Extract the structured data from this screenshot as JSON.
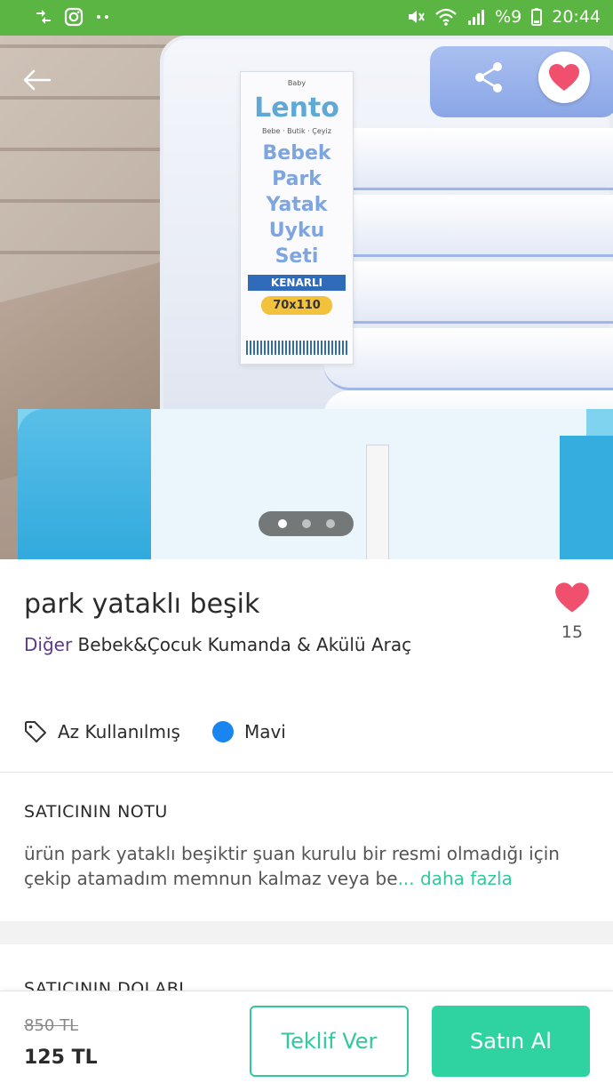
{
  "status_bar": {
    "time": "20:44",
    "battery": "%9",
    "icons": [
      "usb-icon",
      "instagram-icon",
      "more-icon",
      "mute-icon",
      "wifi-icon",
      "signal-icon",
      "battery-icon"
    ]
  },
  "gallery": {
    "image_count": 3,
    "active_index": 0,
    "favorite_active": true,
    "label_text": {
      "baby": "Baby",
      "brand": "Lento",
      "tagline": "Bebe · Butik · Çeyiz",
      "lines": [
        "Bebek",
        "Park",
        "Yatak",
        "Uyku",
        "Seti"
      ],
      "strip": "KENARLI",
      "size": "70x110"
    }
  },
  "product": {
    "title": "park yataklı beşik",
    "category": "Diğer",
    "breadcrumb": "Bebek&Çocuk Kumanda & Akülü Araç",
    "likes": "15",
    "condition": "Az Kullanılmış",
    "color_name": "Mavi",
    "color_hex": "#1a84f0"
  },
  "seller_note": {
    "title": "SATICININ NOTU",
    "text": "ürün park yataklı beşiktir şuan kurulu bir resmi olmadığı için çekip atamadım memnun kalmaz veya be",
    "ellipsis": "...",
    "more_label": "daha fazla"
  },
  "closet": {
    "title": "SATICININ DOLABI"
  },
  "bottom_bar": {
    "old_price": "850 TL",
    "price": "125 TL",
    "offer_label": "Teklif Ver",
    "buy_label": "Satın Al"
  },
  "colors": {
    "status_bar": "#5bb543",
    "accent": "#33c79f",
    "buy_button": "#2fd3a1",
    "heart": "#f0506e",
    "category": "#5a3a8c"
  }
}
